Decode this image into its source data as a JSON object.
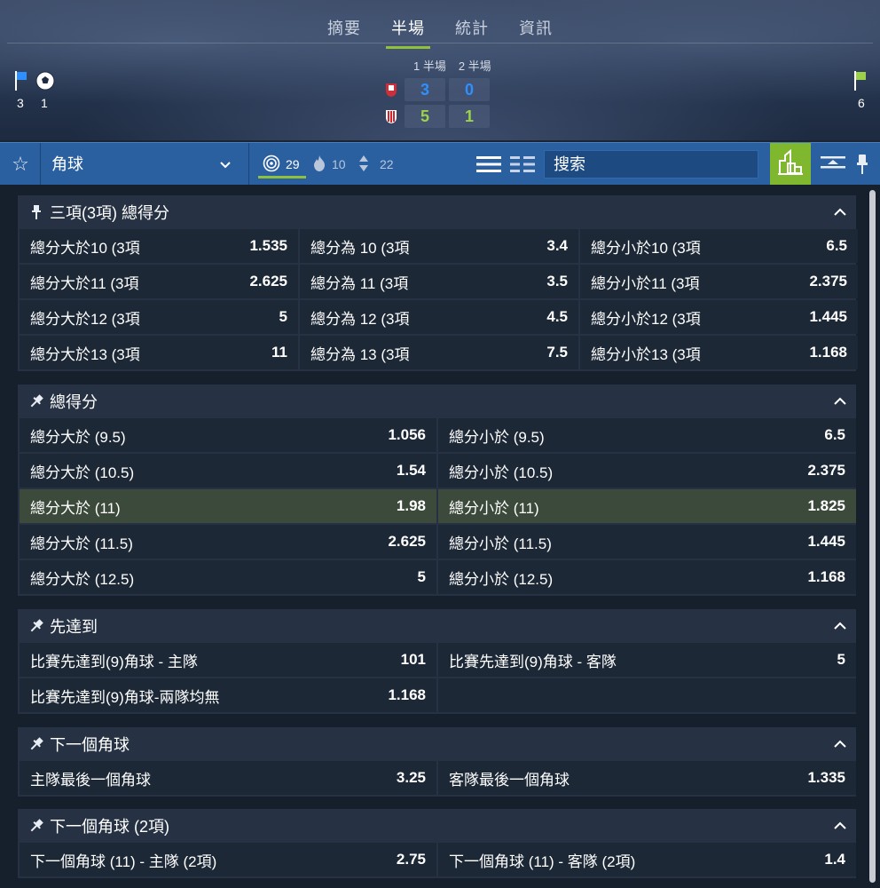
{
  "header": {
    "tabs": [
      {
        "label": "摘要",
        "active": false
      },
      {
        "label": "半場",
        "active": true
      },
      {
        "label": "統計",
        "active": false
      },
      {
        "label": "資訊",
        "active": false
      }
    ],
    "half_labels": [
      "1 半場",
      "2 半場"
    ],
    "home": {
      "first_half": "3",
      "second_half": "0"
    },
    "away": {
      "first_half": "5",
      "second_half": "1"
    },
    "left_counts": {
      "flags": "3",
      "goals": "1"
    },
    "right_counts": {
      "flags": "6"
    }
  },
  "toolbar": {
    "market_select": "角球",
    "counts": [
      {
        "icon": "target-icon",
        "value": "29",
        "active": true
      },
      {
        "icon": "fire-icon",
        "value": "10",
        "active": false
      },
      {
        "icon": "updown-icon",
        "value": "22",
        "active": false
      }
    ],
    "search_label": "搜索",
    "colors": {
      "toolbar": "#2a5fa0",
      "accent": "#8fc23a"
    }
  },
  "sections": [
    {
      "title": "三項(3項) 總得分",
      "columns": 3,
      "rows": [
        [
          {
            "label": "總分大於10 (3項",
            "odd": "1.535"
          },
          {
            "label": "總分為 10 (3項",
            "odd": "3.4"
          },
          {
            "label": "總分小於10 (3項",
            "odd": "6.5"
          }
        ],
        [
          {
            "label": "總分大於11 (3項",
            "odd": "2.625"
          },
          {
            "label": "總分為 11 (3項",
            "odd": "3.5"
          },
          {
            "label": "總分小於11 (3項",
            "odd": "2.375"
          }
        ],
        [
          {
            "label": "總分大於12 (3項",
            "odd": "5"
          },
          {
            "label": "總分為 12 (3項",
            "odd": "4.5"
          },
          {
            "label": "總分小於12 (3項",
            "odd": "1.445"
          }
        ],
        [
          {
            "label": "總分大於13 (3項",
            "odd": "11"
          },
          {
            "label": "總分為 13 (3項",
            "odd": "7.5"
          },
          {
            "label": "總分小於13 (3項",
            "odd": "1.168"
          }
        ]
      ]
    },
    {
      "title": "總得分",
      "columns": 2,
      "rows": [
        [
          {
            "label": "總分大於 (9.5)",
            "odd": "1.056"
          },
          {
            "label": "總分小於 (9.5)",
            "odd": "6.5"
          }
        ],
        [
          {
            "label": "總分大於 (10.5)",
            "odd": "1.54"
          },
          {
            "label": "總分小於 (10.5)",
            "odd": "2.375"
          }
        ],
        [
          {
            "label": "總分大於 (11)",
            "odd": "1.98",
            "highlight": true
          },
          {
            "label": "總分小於 (11)",
            "odd": "1.825",
            "highlight": true
          }
        ],
        [
          {
            "label": "總分大於 (11.5)",
            "odd": "2.625"
          },
          {
            "label": "總分小於 (11.5)",
            "odd": "1.445"
          }
        ],
        [
          {
            "label": "總分大於 (12.5)",
            "odd": "5"
          },
          {
            "label": "總分小於 (12.5)",
            "odd": "1.168"
          }
        ]
      ]
    },
    {
      "title": "先達到",
      "columns": 2,
      "rows": [
        [
          {
            "label": "比賽先達到(9)角球 - 主隊",
            "odd": "101"
          },
          {
            "label": "比賽先達到(9)角球 - 客隊",
            "odd": "5"
          }
        ],
        [
          {
            "label": "比賽先達到(9)角球-兩隊均無",
            "odd": "1.168"
          },
          {
            "label": "",
            "odd": ""
          }
        ]
      ]
    },
    {
      "title": "下一個角球",
      "columns": 2,
      "rows": [
        [
          {
            "label": "主隊最後一個角球",
            "odd": "3.25"
          },
          {
            "label": "客隊最後一個角球",
            "odd": "1.335"
          }
        ]
      ]
    },
    {
      "title": "下一個角球 (2項)",
      "columns": 2,
      "rows": [
        [
          {
            "label": "下一個角球 (11) - 主隊 (2項)",
            "odd": "2.75"
          },
          {
            "label": "下一個角球 (11) - 客隊 (2項)",
            "odd": "1.4"
          }
        ]
      ]
    }
  ]
}
